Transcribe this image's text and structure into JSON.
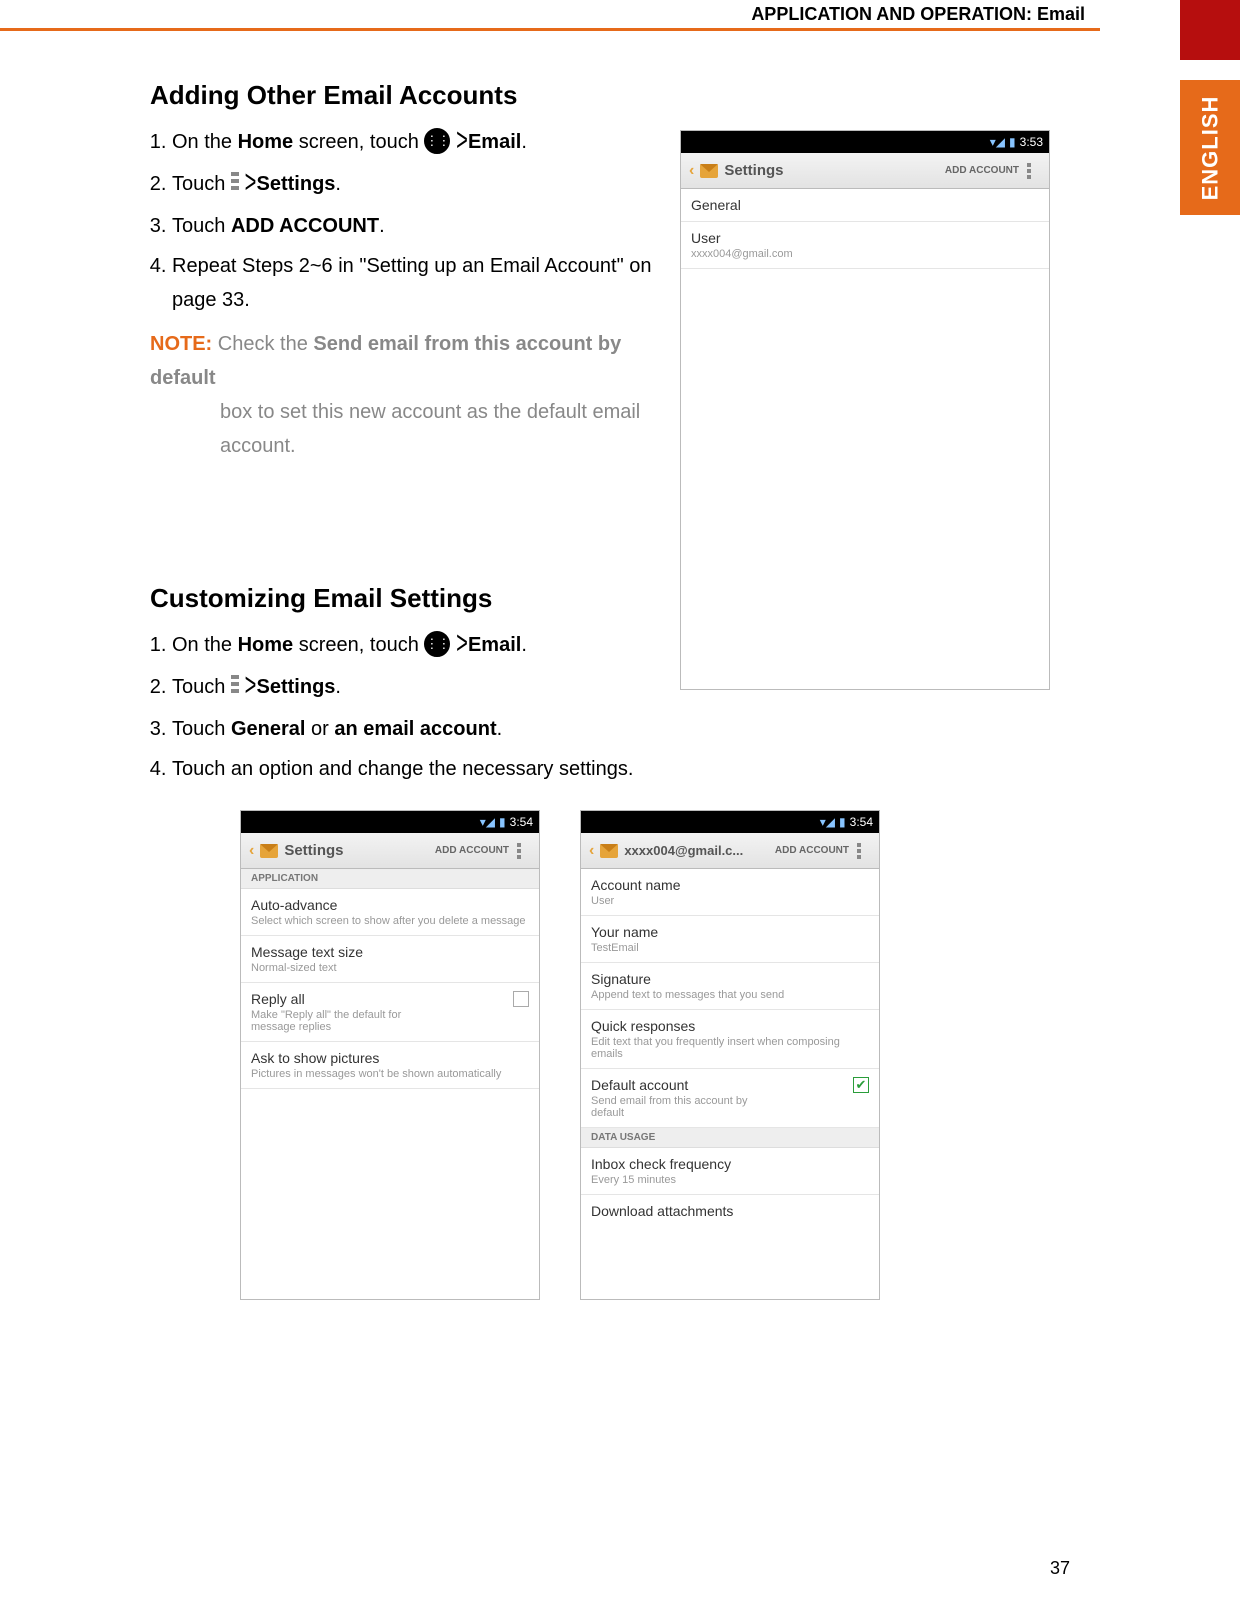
{
  "header": {
    "title": "APPLICATION AND OPERATION: Email",
    "language_tab": "ENGLISH"
  },
  "page_number": "37",
  "section1": {
    "heading": "Adding Other Email Accounts",
    "steps": {
      "s1_a": "On the ",
      "s1_b": "Home",
      "s1_c": " screen, touch ",
      "s1_d": " > ",
      "s1_e": "Email",
      "s1_f": ".",
      "s2_a": "Touch ",
      "s2_b": " > ",
      "s2_c": "Settings",
      "s2_d": ".",
      "s3_a": "Touch ",
      "s3_b": "ADD ACCOUNT",
      "s3_c": ".",
      "s4": "Repeat Steps 2~6 in \"Setting up an Email Account\" on page 33."
    },
    "note": {
      "label": "NOTE:",
      "bold1": "Send email from this account by default",
      "line1_a": " Check the ",
      "line2": " box to set this new account as the default email account."
    }
  },
  "section2": {
    "heading": "Customizing Email Settings",
    "steps": {
      "s1_a": "On the ",
      "s1_b": "Home",
      "s1_c": " screen, touch ",
      "s1_d": " > ",
      "s1_e": "Email",
      "s1_f": ".",
      "s2_a": "Touch ",
      "s2_b": " > ",
      "s2_c": "Settings",
      "s2_d": ".",
      "s3_a": "Touch ",
      "s3_b": "General",
      "s3_c": " or ",
      "s3_d": "an email account",
      "s3_e": ".",
      "s4": "Touch an option and change the necessary settings."
    }
  },
  "phoneA": {
    "time": "3:53",
    "appbar_title": "Settings",
    "add_account": "ADD ACCOUNT",
    "items": {
      "general": "General",
      "user_t": "User",
      "user_s": "xxxx004@gmail.com"
    }
  },
  "phoneB": {
    "time": "3:54",
    "appbar_title": "Settings",
    "add_account": "ADD ACCOUNT",
    "section_header": "APPLICATION",
    "i1_t": "Auto-advance",
    "i1_s": "Select which screen to show after you delete a message",
    "i2_t": "Message text size",
    "i2_s": "Normal-sized text",
    "i3_t": "Reply all",
    "i3_s": "Make \"Reply all\" the default for message replies",
    "i4_t": "Ask to show pictures",
    "i4_s": "Pictures in messages won't be shown automatically"
  },
  "phoneC": {
    "time": "3:54",
    "appbar_title": "xxxx004@gmail.c...",
    "add_account": "ADD ACCOUNT",
    "i1_t": "Account name",
    "i1_s": "User",
    "i2_t": "Your name",
    "i2_s": "TestEmail",
    "i3_t": "Signature",
    "i3_s": "Append text to messages that you send",
    "i4_t": "Quick responses",
    "i4_s": "Edit text that you frequently insert when composing emails",
    "i5_t": "Default account",
    "i5_s": "Send email from this account by default",
    "section_header": "DATA USAGE",
    "i6_t": "Inbox check frequency",
    "i6_s": "Every 15 minutes",
    "i7_t": "Download attachments"
  }
}
